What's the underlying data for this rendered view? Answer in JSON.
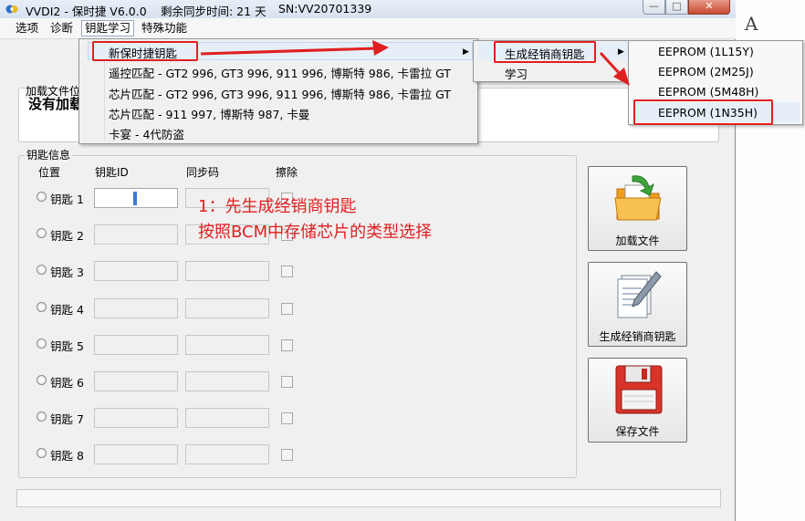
{
  "window": {
    "title": "VVDI2 - 保时捷 V6.0.0",
    "sync": "剩余同步时间: 21 天",
    "serial": "SN:VV20701339",
    "minimize": "—",
    "maximize": "□",
    "close": "✕"
  },
  "menubar": {
    "items": [
      "选项",
      "诊断",
      "钥匙学习",
      "特殊功能"
    ]
  },
  "load_file": {
    "legend": "加载文件位",
    "status": "没有加载"
  },
  "key_info": {
    "legend": "钥匙信息",
    "headers": [
      "位置",
      "钥匙ID",
      "同步码",
      "擦除"
    ],
    "rows": [
      "钥匙 1",
      "钥匙 2",
      "钥匙 3",
      "钥匙 4",
      "钥匙 5",
      "钥匙 6",
      "钥匙 7",
      "钥匙 8"
    ]
  },
  "buttons": {
    "load": "加载文件",
    "generate": "生成经销商钥匙",
    "save": "保存文件"
  },
  "annotation": {
    "line1": "1：先生成经销商钥匙",
    "line2": "按照BCM中存储芯片的类型选择"
  },
  "menu_level1": {
    "items": [
      "新保时捷钥匙",
      "遥控匹配 - GT2 996, GT3 996, 911 996, 博斯特 986, 卡雷拉 GT",
      "芯片匹配 - GT2 996, GT3 996, 911 996, 博斯特 986, 卡雷拉 GT",
      "芯片匹配 - 911 997, 博斯特 987, 卡曼",
      "卡宴 - 4代防盗"
    ],
    "arrow": "▶"
  },
  "menu_level2": {
    "items": [
      "生成经销商钥匙",
      "学习"
    ],
    "arrow": "▶"
  },
  "menu_level3": {
    "items": [
      "EEPROM (1L15Y)",
      "EEPROM (2M25J)",
      "EEPROM (5M48H)",
      "EEPROM (1N35H)"
    ]
  },
  "background": {
    "fragment": "A"
  },
  "colors": {
    "annotation_red": "#e02020",
    "menu_highlight": "#e6eef8",
    "close_button": "#c84a30"
  }
}
